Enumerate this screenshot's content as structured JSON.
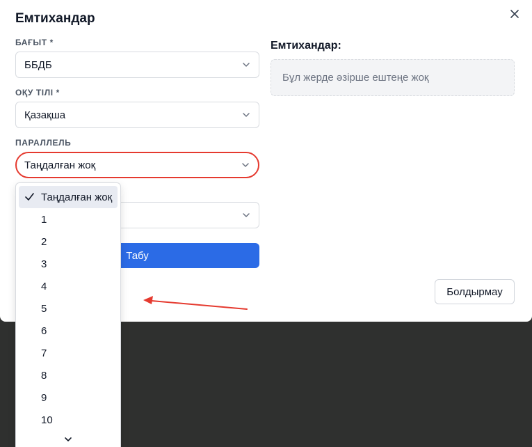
{
  "modal": {
    "title": "Емтихандар",
    "close_icon": "close-icon"
  },
  "form": {
    "direction": {
      "label": "БАҒЫТ *",
      "value": "ББДБ"
    },
    "language": {
      "label": "ОҚУ ТІЛІ *",
      "value": "Қазақша"
    },
    "parallel": {
      "label": "ПАРАЛЛЕЛЬ",
      "value": "Таңдалған жоқ"
    },
    "fourth": {
      "value": ""
    },
    "find_label": "Табу"
  },
  "results": {
    "title": "Емтихандар:",
    "empty_text": "Бұл жерде әзірше ештеңе жоқ"
  },
  "footer": {
    "cancel_label": "Болдырмау"
  },
  "dropdown": {
    "options": [
      "Таңдалған жоқ",
      "1",
      "2",
      "3",
      "4",
      "5",
      "6",
      "7",
      "8",
      "9",
      "10"
    ],
    "selected_index": 0
  },
  "colors": {
    "primary": "#2b6be6",
    "annotation": "#e53a2f"
  }
}
